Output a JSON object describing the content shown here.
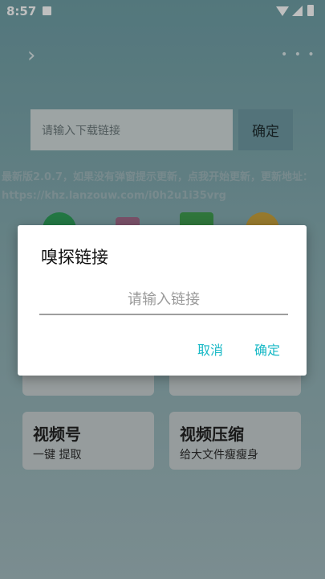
{
  "status_bar": {
    "time": "8:57"
  },
  "search": {
    "placeholder": "请输入下载链接",
    "confirm_label": "确定"
  },
  "notice": "最新版2.0.7，如果没有弹窗提示更新，点我开始更新，更新地址：https://khz.lanzouw.com/i0h2u1i35vrg",
  "tiles": [
    {
      "title": "视频号",
      "subtitle": "一键 提取"
    },
    {
      "title": "视频压缩",
      "subtitle": "给大文件瘦瘦身"
    }
  ],
  "dialog": {
    "title": "嗅探链接",
    "input_placeholder": "请输入链接",
    "cancel_label": "取消",
    "confirm_label": "确定"
  },
  "colors": {
    "accent": "#19b9c6",
    "header_bg": "#6f9fa6"
  }
}
